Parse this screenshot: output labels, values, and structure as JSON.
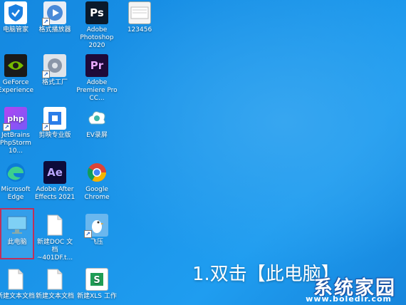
{
  "desktop": {
    "icons": [
      {
        "label": "电脑管家",
        "icon": "shield-icon"
      },
      {
        "label": "格式播放器",
        "icon": "media-player-icon"
      },
      {
        "label": "Adobe Photoshop 2020",
        "icon": "photoshop-icon",
        "glyph": "Ps"
      },
      {
        "label": "123456",
        "icon": "folder-icon"
      },
      {
        "label": "GeForce Experience",
        "icon": "geforce-icon"
      },
      {
        "label": "格式工厂",
        "icon": "format-factory-icon"
      },
      {
        "label": "Adobe Premiere Pro CC...",
        "icon": "premiere-icon",
        "glyph": "Pr"
      },
      {
        "label": "JetBrains PhpStorm 10...",
        "icon": "phpstorm-icon",
        "glyph": "php"
      },
      {
        "label": "剪映专业版",
        "icon": "jianying-icon"
      },
      {
        "label": "EV录屏",
        "icon": "ev-recorder-icon"
      },
      {
        "label": "Microsoft Edge",
        "icon": "edge-icon"
      },
      {
        "label": "Adobe After Effects 2021",
        "icon": "after-effects-icon",
        "glyph": "Ae"
      },
      {
        "label": "Google Chrome",
        "icon": "chrome-icon"
      },
      {
        "label": "此电脑",
        "icon": "this-pc-icon"
      },
      {
        "label": "新建DOC 文档~401DF.t...",
        "icon": "document-icon"
      },
      {
        "label": "飞压",
        "icon": "feiya-icon"
      },
      {
        "label": "新建文本文档",
        "icon": "text-document-icon"
      },
      {
        "label": "新建文本文档",
        "icon": "text-document-icon"
      },
      {
        "label": "新建XLS 工作",
        "icon": "spreadsheet-icon"
      }
    ]
  },
  "caption": "1.双击【此电脑】",
  "watermark": {
    "title": "系统家园",
    "url": "www.boledir.com"
  }
}
